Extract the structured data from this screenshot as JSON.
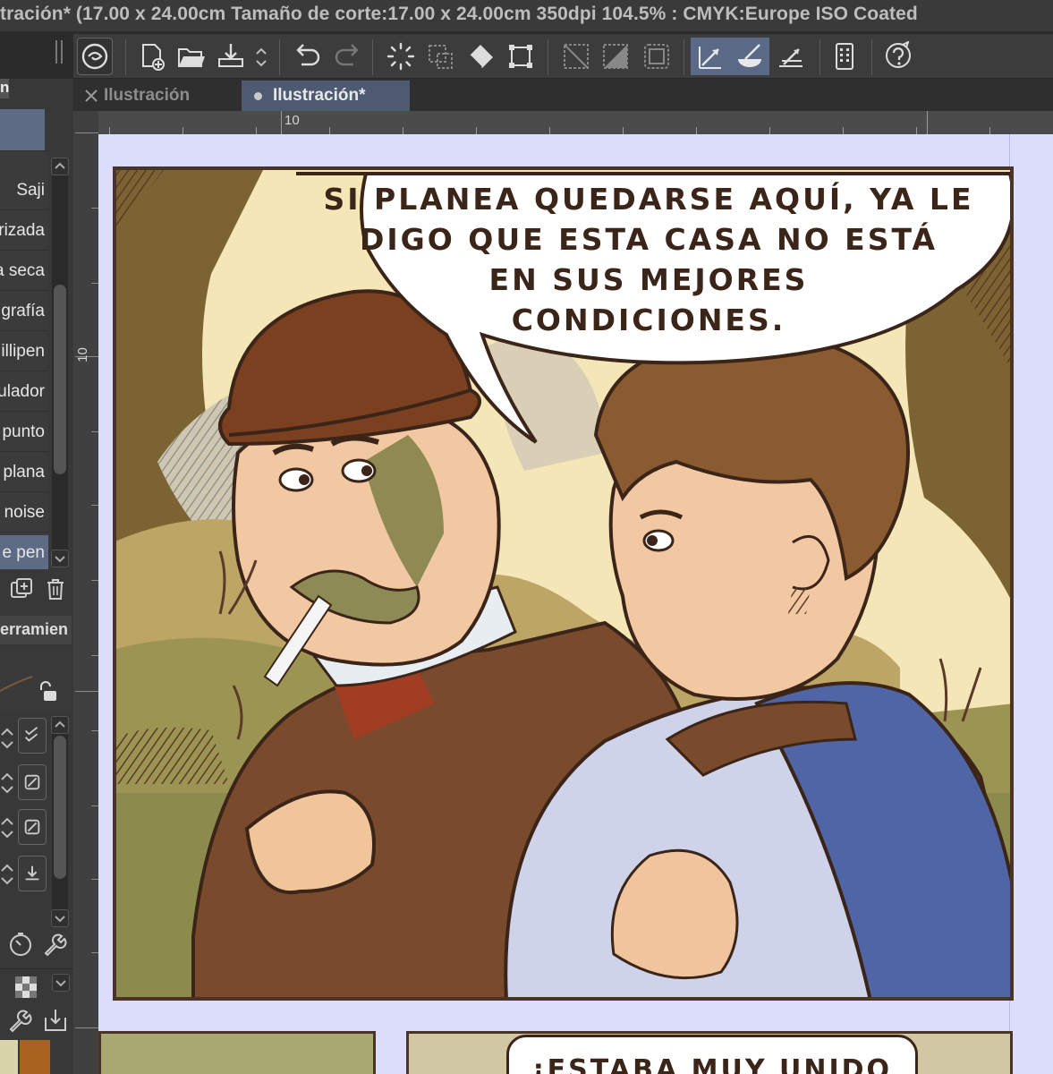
{
  "window": {
    "title": "tración* (17.00 x 24.00cm Tamaño de corte:17.00 x 24.00cm 350dpi 104.5% : CMYK:Europe ISO Coated"
  },
  "tabs": [
    {
      "label": "Ilustración",
      "state": "inactive",
      "icon": "close-icon"
    },
    {
      "label": "Ilustración*",
      "state": "active",
      "icon": "unsaved-dot-icon"
    }
  ],
  "rulers": {
    "horizontal_label": "10",
    "vertical_label": "10"
  },
  "left_panel": {
    "panel_tab_glyph": "n",
    "brushes": [
      "Saji",
      "rizada",
      "a seca",
      "grafía",
      "illipen",
      "ulador",
      "punto",
      "plana",
      "noise",
      "e pen"
    ],
    "selected_brush": "e pen",
    "tool_property_header": "erramien",
    "swatches": [
      "#d8d3a8",
      "#a8621f"
    ]
  },
  "toolbar": {
    "icons": [
      "clip-studio-icon",
      "new-file-icon",
      "open-folder-icon",
      "export-icon",
      "undo-icon",
      "redo-icon",
      "selection-sparkle-icon",
      "selection-crop-icon",
      "fill-icon",
      "transform-icon",
      "grid-off-icon",
      "snap-off-icon",
      "frame-border-icon",
      "snap-to-ruler-icon",
      "snap-to-special-ruler-icon",
      "perspective-ruler-icon",
      "device-settings-icon",
      "help-icon"
    ],
    "active_icons": [
      "snap-to-ruler-icon",
      "snap-to-special-ruler-icon"
    ]
  },
  "comic": {
    "speech_bubble_lines": [
      "SI PLANEA QUEDARSE AQUÍ, YA LE",
      "DIGO QUE ESTA CASA NO ESTÁ",
      "EN SUS MEJORES",
      "CONDICIONES."
    ],
    "next_panel_text": "¡ESTABA MUY UNIDO"
  },
  "colors": {
    "canvas_background": "#dcdcfb",
    "accent_selected": "#5d6b85",
    "panel_border": "#4a3327"
  }
}
